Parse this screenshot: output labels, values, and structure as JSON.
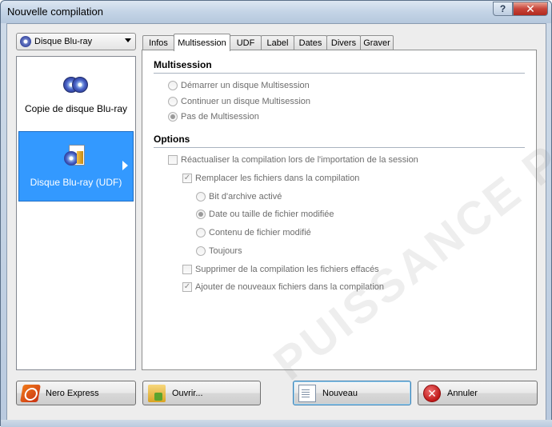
{
  "window": {
    "title": "Nouvelle compilation",
    "help_label": "?",
    "close_label": "✕"
  },
  "combo": {
    "selected": "Disque Blu-ray"
  },
  "left_list": {
    "items": [
      {
        "label": "Copie de disque Blu-ray",
        "icon": "bluray-discs-icon",
        "selected": false
      },
      {
        "label": "Disque Blu-ray (UDF)",
        "icon": "bluray-udf-icon",
        "selected": true
      }
    ]
  },
  "tabs": [
    {
      "label": "Infos",
      "active": false
    },
    {
      "label": "Multisession",
      "active": true
    },
    {
      "label": "UDF",
      "active": false
    },
    {
      "label": "Label",
      "active": false
    },
    {
      "label": "Dates",
      "active": false
    },
    {
      "label": "Divers",
      "active": false
    },
    {
      "label": "Graver",
      "active": false
    }
  ],
  "multisession": {
    "title": "Multisession",
    "options": [
      {
        "label": "Démarrer un disque Multisession",
        "checked": false
      },
      {
        "label": "Continuer un disque Multisession",
        "checked": false
      },
      {
        "label": "Pas de Multisession",
        "checked": true
      }
    ]
  },
  "options": {
    "title": "Options",
    "refresh": {
      "label": "Réactualiser la compilation lors de l'importation de la session",
      "checked": false
    },
    "replace": {
      "label": "Remplacer les fichiers dans la compilation",
      "checked": true
    },
    "replace_modes": [
      {
        "label": "Bit d'archive activé",
        "checked": false
      },
      {
        "label": "Date ou taille de fichier modifiée",
        "checked": true
      },
      {
        "label": "Contenu de fichier modifié",
        "checked": false
      },
      {
        "label": "Toujours",
        "checked": false
      }
    ],
    "delete_removed": {
      "label": "Supprimer de la compilation les fichiers effacés",
      "checked": false
    },
    "add_new": {
      "label": "Ajouter de nouveaux fichiers dans la compilation",
      "checked": true
    }
  },
  "watermark": "PUISSANCE PC",
  "buttons": {
    "nero_express": "Nero Express",
    "open": "Ouvrir...",
    "new": "Nouveau",
    "cancel": "Annuler"
  }
}
